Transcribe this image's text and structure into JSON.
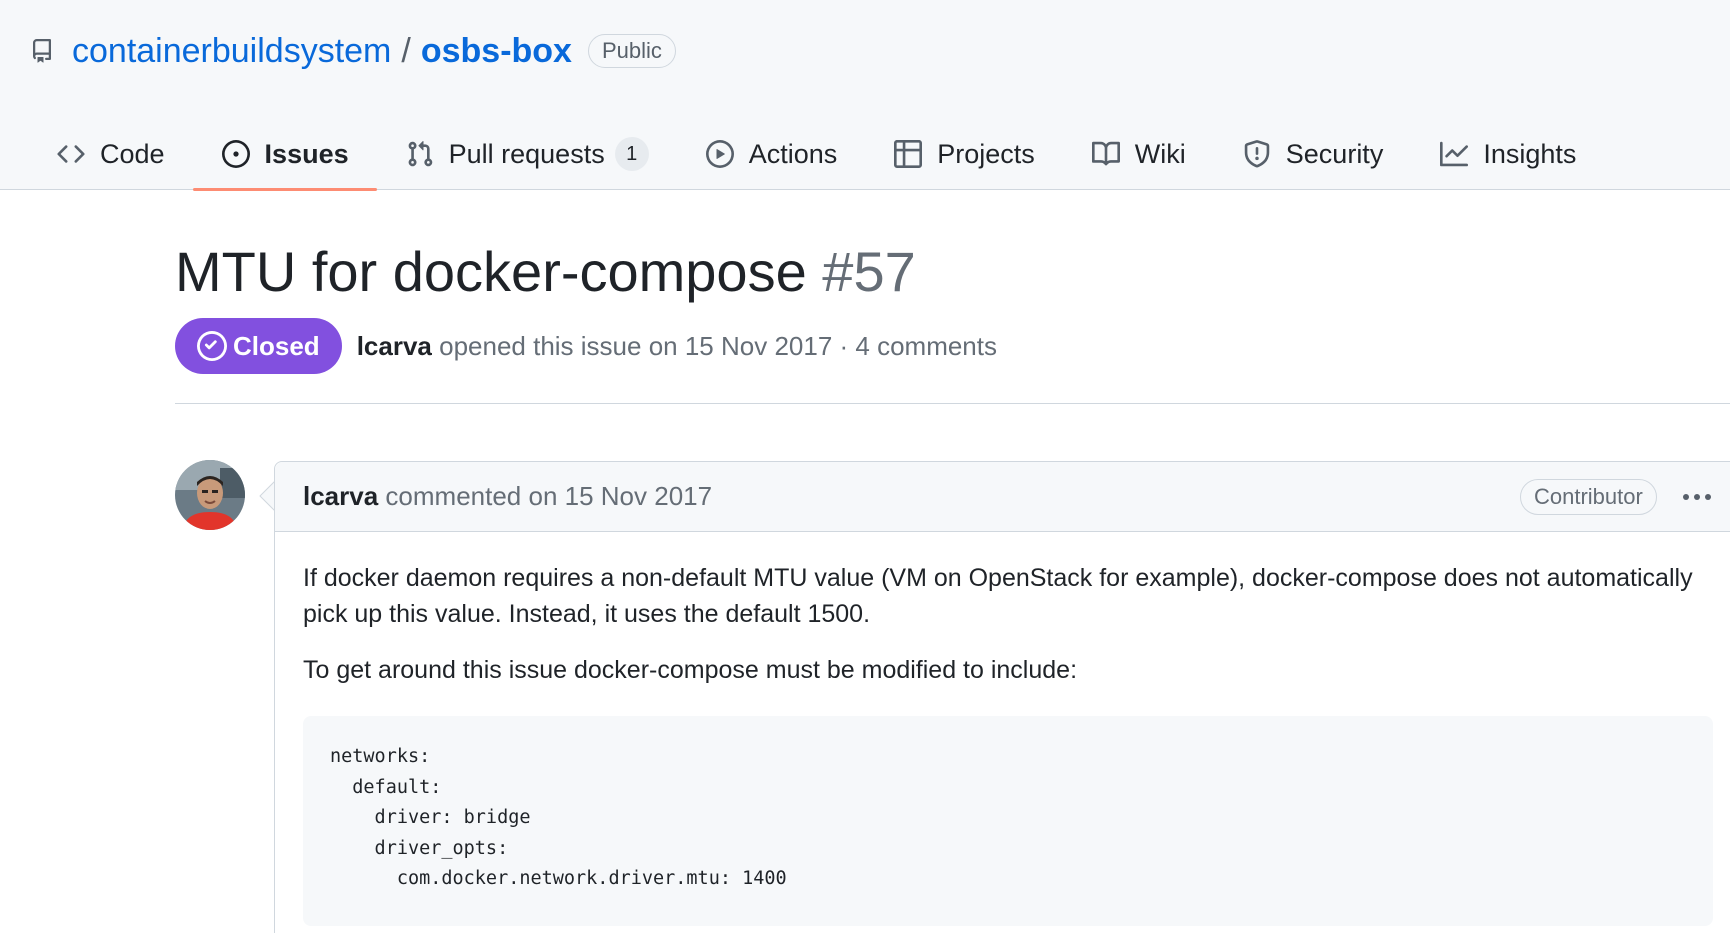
{
  "repo": {
    "owner": "containerbuildsystem",
    "separator": "/",
    "name": "osbs-box",
    "visibility": "Public"
  },
  "nav": {
    "tabs": [
      {
        "label": "Code",
        "icon": "code-icon"
      },
      {
        "label": "Issues",
        "icon": "issue-opened-icon",
        "selected": true
      },
      {
        "label": "Pull requests",
        "icon": "git-pull-request-icon",
        "count": "1"
      },
      {
        "label": "Actions",
        "icon": "play-icon"
      },
      {
        "label": "Projects",
        "icon": "table-icon"
      },
      {
        "label": "Wiki",
        "icon": "book-icon"
      },
      {
        "label": "Security",
        "icon": "shield-icon"
      },
      {
        "label": "Insights",
        "icon": "graph-icon"
      }
    ]
  },
  "issue": {
    "title": "MTU for docker-compose",
    "number": "#57",
    "state": "Closed",
    "author": "lcarva",
    "opened_text": "opened this issue on 15 Nov 2017 · 4 comments"
  },
  "comment": {
    "author": "lcarva",
    "header_text": "commented on 15 Nov 2017",
    "role": "Contributor",
    "paragraphs": [
      "If docker daemon requires a non-default MTU value (VM on OpenStack for example), docker-compose does not automatically pick up this value. Instead, it uses the default 1500.",
      "To get around this issue docker-compose must be modified to include:"
    ],
    "code": "networks:\n  default:\n    driver: bridge\n    driver_opts:\n      com.docker.network.driver.mtu: 1400"
  },
  "colors": {
    "link": "#0969da",
    "closed_badge": "#8250df",
    "selected_tab_underline": "#fd8c73",
    "header_bg": "#f6f8fa"
  }
}
